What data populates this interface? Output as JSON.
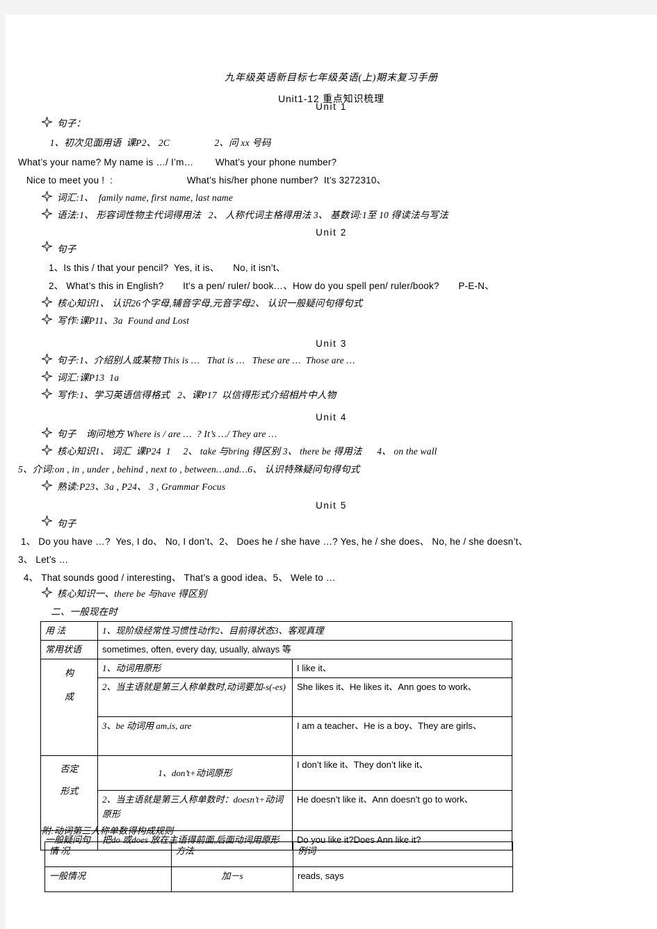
{
  "document": {
    "title_line1": "九年级英语新目标七年级英语(上)期末复习手册",
    "title_line2": "Unit1-12 重点知识梳理"
  },
  "units": [
    {
      "heading": "Unit  1",
      "lines": [
        {
          "bullet": true,
          "text": "句子："
        },
        {
          "bullet": false,
          "text": " 1、初次见面用语  课P2、 2C                  2、问 xx 号码"
        },
        {
          "bullet": false,
          "text": "What’s your name? My name is …/ I’m…        What’s your phone number?"
        },
        {
          "bullet": false,
          "text": "   Nice to meet you !  :                           What’s his/her phone number?  It’s 3272310、"
        },
        {
          "bullet": true,
          "text": "词汇:1、  family name, first name, last name"
        },
        {
          "bullet": true,
          "text": "语法:1、 形容词性物主代词得用法   2、 人称代词主格得用法 3、 基数词:1至 10 得读法与写法"
        }
      ]
    },
    {
      "heading": "Unit  2",
      "lines": [
        {
          "bullet": true,
          "text": "句子"
        },
        {
          "bullet": false,
          "text": " 1、Is this / that your pencil?  Yes, it is、     No, it isn’t、"
        },
        {
          "bullet": false,
          "text": " 2、 What’s this in English?       It’s a pen/ ruler/ book…、How do you spell pen/ ruler/book?       P-E-N、"
        },
        {
          "bullet": true,
          "text": "核心知识1、 认识26个字母,辅音字母,元音字母2、 认识一般疑问句得句式"
        },
        {
          "bullet": true,
          "text": "写作:课P11、3a  Found and Lost"
        }
      ]
    },
    {
      "heading": "Unit  3",
      "lines": [
        {
          "bullet": true,
          "text": "句子:1、介绍别人或某物 This is …   That is …   These are …  Those are …"
        },
        {
          "bullet": true,
          "text": "词汇:课P13  1a"
        },
        {
          "bullet": true,
          "text": "写作:1、学习英语信得格式   2、课P17  以信得形式介绍相片中人物"
        }
      ]
    },
    {
      "heading": "Unit  4",
      "lines": [
        {
          "bullet": true,
          "text": "句子    询问地方 Where is / are …  ? It’s …/ They are …"
        },
        {
          "bullet": true,
          "text": "核心知识1、 词汇  课P24  1     2、 take 与bring 得区别 3、 there be 得用法      4、 on the wall"
        },
        {
          "bullet": false,
          "text": "5、介词:on , in , under , behind , next to , between…and…6、 认识特殊疑问句得句式"
        },
        {
          "bullet": true,
          "text": "熟读:P23、3a , P24、 3 , Grammar Focus"
        }
      ]
    },
    {
      "heading": "Unit  5",
      "lines": [
        {
          "bullet": true,
          "text": "句子"
        },
        {
          "bullet": false,
          "text": " 1、 Do you have …?  Yes, I do、 No, I don’t、2、 Does he / she have …? Yes, he / she does、 No, he / she doesn’t、"
        },
        {
          "bullet": false,
          "text": "3、 Let’s …"
        },
        {
          "bullet": false,
          "text": "  4、 That sounds good / interesting、 That’s a good idea、5、 Wele to …"
        },
        {
          "bullet": true,
          "text": "核心知识一、there be 与have 得区别"
        },
        {
          "bullet": false,
          "text": "  二、一般现在时"
        }
      ]
    }
  ],
  "table_present_simple": {
    "rows": [
      {
        "label": "用  法",
        "col2": "1、现阶级经常性习惯性动作2、目前得状态3、客观真理"
      },
      {
        "label": "常用状语",
        "col2": "sometimes, often, every day, usually, always 等"
      },
      {
        "label": "构\n成",
        "items": [
          {
            "rule": "1、动词用原形",
            "example": "I like it、"
          },
          {
            "rule": "  2、当主语就是第三人称单数时,动词要加-s(-es)",
            "example": "She likes it、He likes it、Ann goes to work、"
          },
          {
            "rule": "3、be 动词用 am,is, are",
            "example": "I am a teacher、He is a boy、They are girls、"
          }
        ]
      },
      {
        "label": "否定\n形式",
        "items": [
          {
            "rule": "1、don’t+动词原形",
            "example": "I don’t like it、They don’t like it、"
          },
          {
            "rule": "2、当主语就是第三人称单数时：doesn’t+动词原形",
            "example": "He doesn’t like it、Ann doesn’t go to work、"
          }
        ]
      },
      {
        "label": "一般疑问句",
        "col2": "把do 或does 放在主语得前面,后面动词用原形",
        "col3": "Do you like it?Does Ann like it?"
      }
    ]
  },
  "appendix": {
    "caption": "附:动词第三人称单数得构成规则",
    "headers": [
      "情    况",
      "方法",
      "例词"
    ],
    "rows": [
      {
        "situation": "一般情况",
        "method": "加－s",
        "examples": "reads, says"
      }
    ]
  }
}
